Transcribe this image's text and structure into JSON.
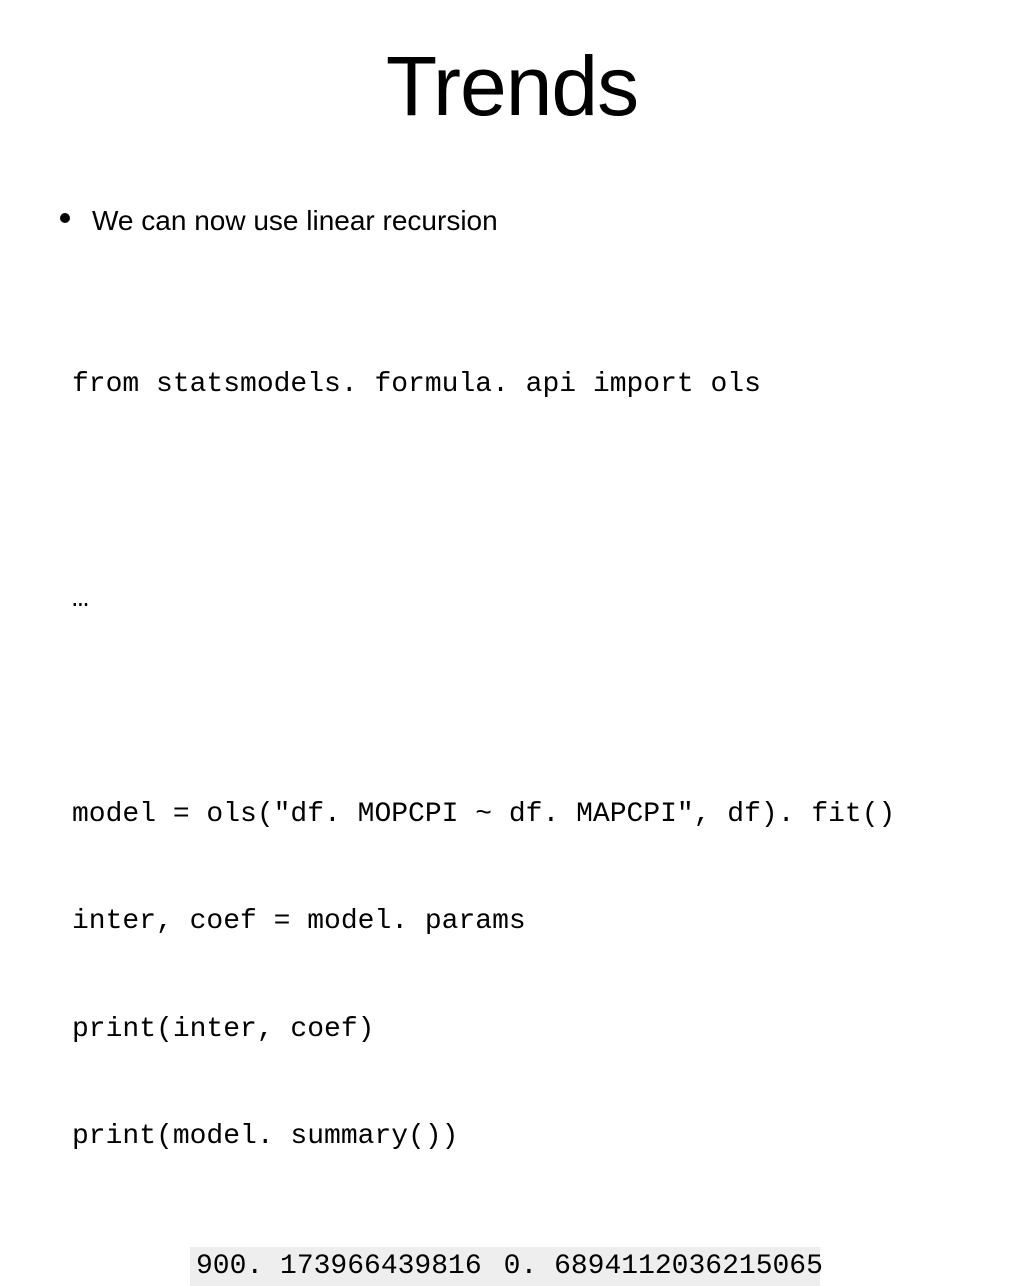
{
  "title": "Trends",
  "bullet": {
    "text": "We can now use linear recursion"
  },
  "code": {
    "line1": "from statsmodels. formula. api import ols",
    "ellipsis": "…",
    "line2": "model = ols(\"df. MOPCPI ~ df. MAPCPI\", df). fit()",
    "line3": "inter, coef = model. params",
    "line4": "print(inter, coef)",
    "line5": "print(model. summary())"
  },
  "output": {
    "val1": "900. 173966439816",
    "val2": "0. 6894112036215065"
  }
}
